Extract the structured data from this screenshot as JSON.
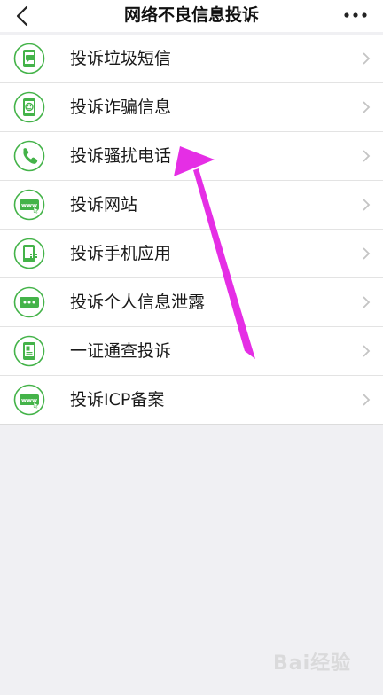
{
  "header": {
    "title": "网络不良信息投诉",
    "back_icon": "chevron-left-icon",
    "more_icon": "more-dots-icon"
  },
  "colors": {
    "accent_green": "#44b349",
    "icon_bg": "#ffffff",
    "arrow_magenta": "#e52ee5"
  },
  "menu": {
    "items": [
      {
        "label": "投诉垃圾短信",
        "icon": "spam-sms-icon"
      },
      {
        "label": "投诉诈骗信息",
        "icon": "fraud-info-icon"
      },
      {
        "label": "投诉骚扰电话",
        "icon": "phone-icon"
      },
      {
        "label": "投诉网站",
        "icon": "website-icon"
      },
      {
        "label": "投诉手机应用",
        "icon": "mobile-app-icon"
      },
      {
        "label": "投诉个人信息泄露",
        "icon": "personal-info-leak-icon"
      },
      {
        "label": "一证通查投诉",
        "icon": "id-check-icon"
      },
      {
        "label": "投诉ICP备案",
        "icon": "icp-record-icon"
      }
    ]
  },
  "watermark": {
    "text": "Bai经验"
  }
}
